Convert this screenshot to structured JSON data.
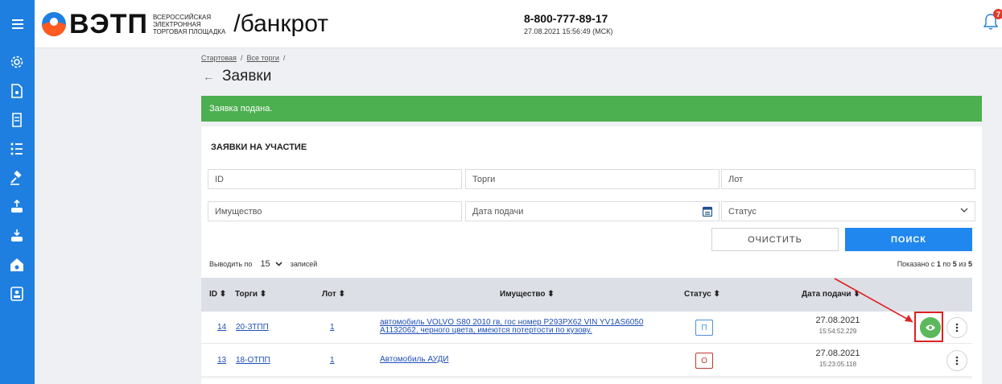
{
  "header": {
    "logo_word": "ВЭТП",
    "logo_sub_line1": "ВСЕРОССИЙСКАЯ",
    "logo_sub_line2": "ЭЛЕКТРОННАЯ",
    "logo_sub_line3": "ТОРГОВАЯ ПЛОЩАДКА",
    "section": "/банкрот",
    "phone": "8-800-777-89-17",
    "datetime": "27.08.2021 15:56:49 (МСК)",
    "notifications_count": "7"
  },
  "sidebar": {
    "icons": [
      "gear-icon",
      "document-star-icon",
      "receipt-icon",
      "ranked-list-icon",
      "gavel-icon",
      "upload-box-icon",
      "download-box-icon",
      "bank-house-icon",
      "registry-icon"
    ]
  },
  "breadcrumb": {
    "home": "Стартовая",
    "sep": "/",
    "all_auctions": "Все торги"
  },
  "page": {
    "title": "Заявки"
  },
  "alert": {
    "text": "Заявка подана."
  },
  "panel": {
    "title": "ЗАЯВКИ НА УЧАСТИЕ",
    "filters": {
      "id_placeholder": "ID",
      "auctions_placeholder": "Торги",
      "lot_placeholder": "Лот",
      "property_placeholder": "Имущество",
      "date_placeholder": "Дата подачи",
      "status_placeholder": "Статус"
    },
    "buttons": {
      "clear": "ОЧИСТИТЬ",
      "search": "ПОИСК"
    },
    "pagination": {
      "show_label": "Выводить по",
      "per_page": "15",
      "records_label": "записей",
      "shown_prefix": "Показано с",
      "shown_from": "1",
      "shown_to_label": "по",
      "shown_to": "5",
      "shown_of_label": "из",
      "shown_total": "5"
    },
    "table": {
      "headers": {
        "id": "ID",
        "auctions": "Торги",
        "lot": "Лот",
        "property": "Имущество",
        "status": "Статус",
        "date": "Дата подачи"
      },
      "sort_glyph": "⬍",
      "rows": [
        {
          "id": "14",
          "auction": "20-ЗТПП",
          "lot": "1",
          "property_line1": "автомобиль VOLVO S80 2010 гв, гос номер Р293РХ62 VIN YV1AS6050",
          "property_line2": "A1132062, черного цвета, имеются потертости по кузову.",
          "status": "П",
          "status_color": "#4a90d9",
          "date": "27.08.2021",
          "time": "15:54:52.229"
        },
        {
          "id": "13",
          "auction": "18-ОТПП",
          "lot": "1",
          "property_line1": "Автомобиль АУДИ",
          "property_line2": "",
          "status": "О",
          "status_color": "#c0392b",
          "date": "27.08.2021",
          "time": "15:23:05.118"
        }
      ]
    }
  },
  "colors": {
    "brand_blue": "#1f7fe0",
    "success_green": "#4caf50",
    "annotation_red": "#e02020"
  }
}
